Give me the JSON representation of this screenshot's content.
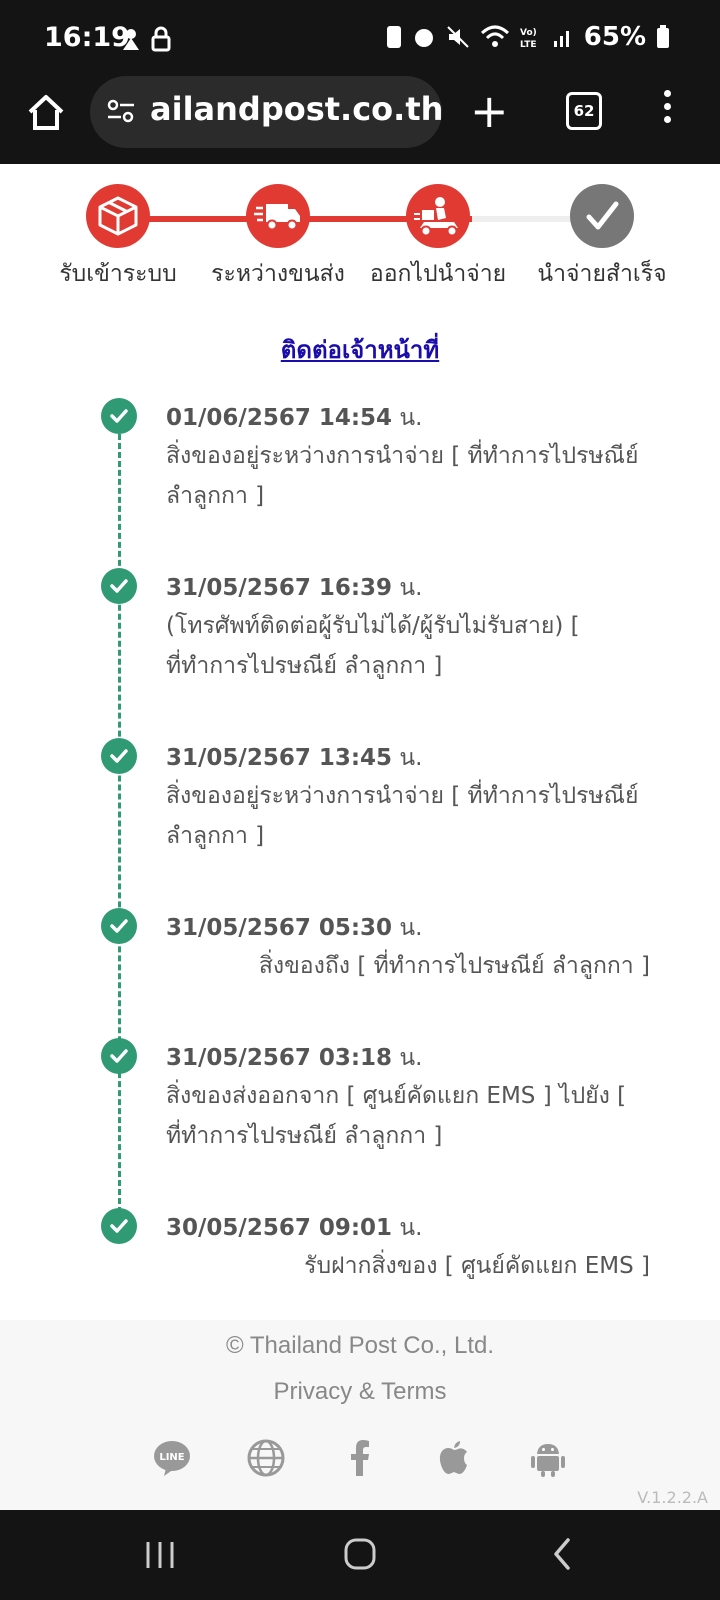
{
  "status_bar": {
    "time": "16:19",
    "battery": "65%"
  },
  "browser": {
    "url": "ailandpost.co.th",
    "tab_count": "62"
  },
  "steps": [
    {
      "label": "รับเข้าระบบ",
      "active": true,
      "icon": "box-icon"
    },
    {
      "label": "ระหว่างขนส่ง",
      "active": true,
      "icon": "truck-icon"
    },
    {
      "label": "ออกไปนำจ่าย",
      "active": true,
      "icon": "courier-icon"
    },
    {
      "label": "นำจ่ายสำเร็จ",
      "active": false,
      "icon": "check-icon"
    }
  ],
  "colors": {
    "accent_red": "#e03a33",
    "inactive_gray": "#777777",
    "timeline_green": "#2f9a74",
    "link_blue": "#1a0dab"
  },
  "contact_link": "ติดต่อเจ้าหน้าที่",
  "timeline": [
    {
      "date": "01/06/2567 14:54",
      "suffix": " น.",
      "desc": "สิ่งของอยู่ระหว่างการนำจ่าย [ ที่ทำการไปรษณีย์ ลำลูกกา ]"
    },
    {
      "date": "31/05/2567 16:39",
      "suffix": " น.",
      "desc": "(โทรศัพท์ติดต่อผู้รับไม่ได้/ผู้รับไม่รับสาย) [ ที่ทำการไปรษณีย์ ลำลูกกา ]"
    },
    {
      "date": "31/05/2567 13:45",
      "suffix": " น.",
      "desc": "สิ่งของอยู่ระหว่างการนำจ่าย [ ที่ทำการไปรษณีย์ ลำลูกกา ]"
    },
    {
      "date": "31/05/2567 05:30",
      "suffix": " น.",
      "desc": "สิ่งของถึง [ ที่ทำการไปรษณีย์ ลำลูกกา ]"
    },
    {
      "date": "31/05/2567 03:18",
      "suffix": " น.",
      "desc": "สิ่งของส่งออกจาก [ ศูนย์คัดแยก EMS ] ไปยัง [ ที่ทำการไปรษณีย์ ลำลูกกา ]"
    },
    {
      "date": "30/05/2567 09:01",
      "suffix": " น.",
      "desc": "รับฝากสิ่งของ [ ศูนย์คัดแยก EMS ]"
    }
  ],
  "footer": {
    "copyright": "© Thailand Post Co., Ltd.",
    "privacy": "Privacy & Terms",
    "social_icons": [
      "line-icon",
      "globe-icon",
      "facebook-icon",
      "apple-icon",
      "android-icon"
    ],
    "version": "V.1.2.2.A"
  }
}
